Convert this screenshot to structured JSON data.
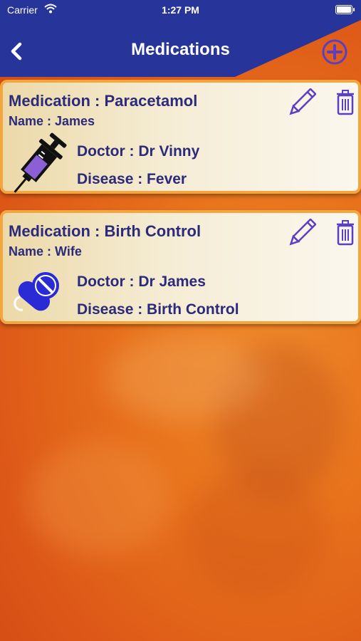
{
  "status_bar": {
    "carrier": "Carrier",
    "time": "1:27 PM"
  },
  "nav": {
    "title": "Medications",
    "back_icon": "chevron-left-icon",
    "add_icon": "plus-circle-icon"
  },
  "colors": {
    "nav_blue": "#27349a",
    "accent_orange": "#e8731c",
    "text_navy": "#2b2b7a",
    "icon_purple": "#5a3fc4"
  },
  "medications": [
    {
      "medication": "Medication : Paracetamol",
      "name": "Name : James",
      "doctor": "Doctor : Dr Vinny",
      "disease": "Disease : Fever",
      "icon": "syringe-icon"
    },
    {
      "medication": "Medication : Birth Control",
      "name": "Name : Wife",
      "doctor": "Doctor : Dr James",
      "disease": "Disease : Birth Control",
      "icon": "pills-icon"
    }
  ]
}
